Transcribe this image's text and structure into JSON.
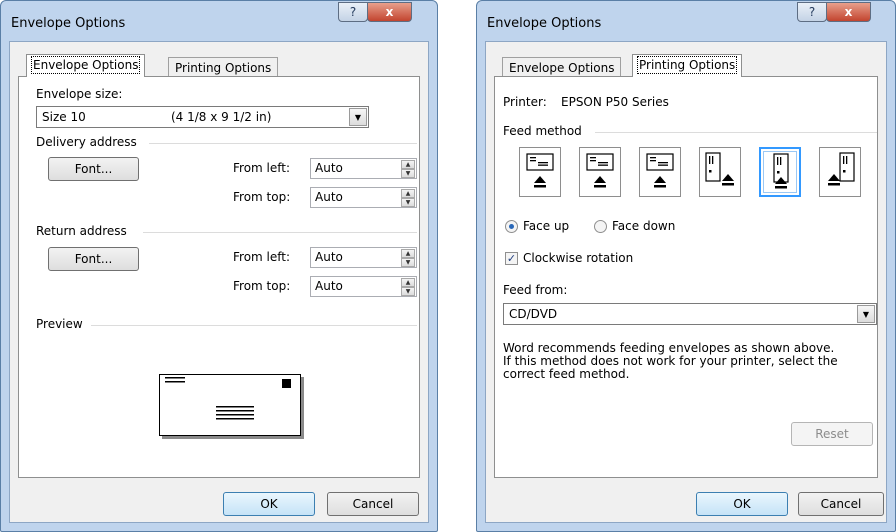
{
  "left_dialog": {
    "title": "Envelope Options",
    "tabs": [
      {
        "label": "Envelope Options",
        "selected": true
      },
      {
        "label": "Printing Options",
        "selected": false
      }
    ],
    "envelope_size_label": "Envelope size:",
    "envelope_size_name": "Size 10",
    "envelope_size_dims": "(4 1/8 x 9 1/2 in)",
    "delivery_address_label": "Delivery address",
    "delivery_font_button": "Font...",
    "delivery_from_left_label": "From left:",
    "delivery_from_left_value": "Auto",
    "delivery_from_top_label": "From top:",
    "delivery_from_top_value": "Auto",
    "return_address_label": "Return address",
    "return_font_button": "Font...",
    "return_from_left_label": "From left:",
    "return_from_left_value": "Auto",
    "return_from_top_label": "From top:",
    "return_from_top_value": "Auto",
    "preview_label": "Preview",
    "ok_button": "OK",
    "cancel_button": "Cancel"
  },
  "right_dialog": {
    "title": "Envelope Options",
    "tabs": [
      {
        "label": "Envelope Options",
        "selected": false
      },
      {
        "label": "Printing Options",
        "selected": true
      }
    ],
    "printer_label": "Printer:",
    "printer_name": "EPSON P50 Series",
    "feed_method_label": "Feed method",
    "feed_methods_selected_index": 4,
    "face_up_label": "Face up",
    "face_up_checked": true,
    "face_down_label": "Face down",
    "face_down_checked": false,
    "clockwise_label": "Clockwise rotation",
    "clockwise_checked": true,
    "feed_from_label": "Feed from:",
    "feed_from_value": "CD/DVD",
    "recommendation_lines": [
      "Word recommends feeding envelopes as shown above.",
      "If this method does not work for your printer, select the",
      "correct feed method."
    ],
    "reset_button": "Reset",
    "ok_button": "OK",
    "cancel_button": "Cancel"
  },
  "icons": {
    "help": "?",
    "close": "x",
    "dropdown": "▼",
    "spin_up": "▲",
    "spin_down": "▼",
    "check": "✓"
  },
  "colors": {
    "accent": "#3399ff",
    "close_button": "#c2442f",
    "window_frame": "#bfd4ed"
  }
}
